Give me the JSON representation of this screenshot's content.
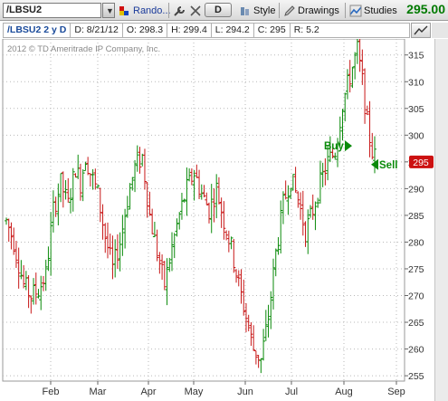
{
  "toolbar": {
    "symbol": "/LBSU2",
    "dropdown_glyph": "▼",
    "random_label": "Rando...",
    "d_label": "D",
    "style_label": "Style",
    "drawings_label": "Drawings",
    "studies_label": "Studies",
    "last_price": "295.00"
  },
  "infobar": {
    "symbol_period": "/LBSU2 2 y D",
    "date": "D: 8/21/12",
    "open": "O: 298.3",
    "high": "H: 299.4",
    "low": "L: 294.2",
    "close": "C: 295",
    "range": "R: 5.2"
  },
  "chart": {
    "copyright": "2012 © TD Ameritrade IP Company, Inc.",
    "price_tag": "295",
    "buy_label": "Buy",
    "sell_label": "Sell"
  },
  "chart_data": {
    "type": "ohlc",
    "x_ticks": [
      "Feb",
      "Mar",
      "Apr",
      "May",
      "Jun",
      "Jul",
      "Aug",
      "Sep"
    ],
    "y_ticks": [
      255,
      260,
      265,
      270,
      275,
      280,
      285,
      290,
      295,
      300,
      305,
      310,
      315
    ],
    "ylim": [
      254,
      318
    ],
    "last_value": 295,
    "colors": {
      "up": "#0a8a0a",
      "down": "#c81818",
      "price_tag_bg": "#cc1111",
      "grid": "#b9b9b9"
    },
    "grid": true,
    "signals": [
      {
        "label": "Buy",
        "value": 298
      },
      {
        "label": "Sell",
        "value": 294.5
      }
    ],
    "path": [
      [
        0,
        284
      ],
      [
        3,
        280
      ],
      [
        7,
        272
      ],
      [
        10,
        270
      ],
      [
        13,
        271
      ],
      [
        16,
        274
      ],
      [
        19,
        286
      ],
      [
        22,
        291
      ],
      [
        25,
        287
      ],
      [
        28,
        294
      ],
      [
        30,
        291
      ],
      [
        32,
        296
      ],
      [
        34,
        293
      ],
      [
        37,
        289
      ],
      [
        40,
        281
      ],
      [
        43,
        275
      ],
      [
        46,
        280
      ],
      [
        49,
        288
      ],
      [
        52,
        294
      ],
      [
        55,
        296
      ],
      [
        58,
        285
      ],
      [
        61,
        278
      ],
      [
        64,
        272
      ],
      [
        67,
        279
      ],
      [
        70,
        285
      ],
      [
        73,
        290
      ],
      [
        76,
        293
      ],
      [
        79,
        289
      ],
      [
        82,
        286
      ],
      [
        85,
        290
      ],
      [
        88,
        284
      ],
      [
        91,
        279
      ],
      [
        94,
        272
      ],
      [
        97,
        266
      ],
      [
        100,
        260
      ],
      [
        103,
        258
      ],
      [
        106,
        266
      ],
      [
        109,
        278
      ],
      [
        112,
        287
      ],
      [
        115,
        292
      ],
      [
        118,
        288
      ],
      [
        121,
        282
      ],
      [
        124,
        286
      ],
      [
        127,
        291
      ],
      [
        130,
        295
      ],
      [
        133,
        297
      ],
      [
        136,
        306
      ],
      [
        139,
        311
      ],
      [
        142,
        316
      ],
      [
        144,
        310
      ],
      [
        146,
        302
      ],
      [
        148,
        297
      ],
      [
        150,
        295
      ]
    ]
  }
}
